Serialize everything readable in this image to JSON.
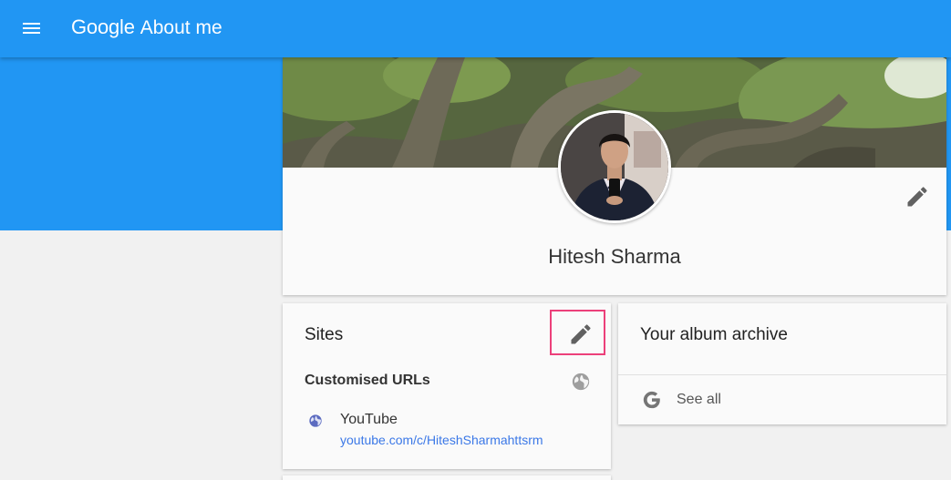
{
  "header": {
    "brand_google": "Google",
    "brand_product": "About me"
  },
  "profile": {
    "name": "Hitesh Sharma"
  },
  "sites": {
    "title": "Sites",
    "section_title": "Customised URLs",
    "links": [
      {
        "name": "YouTube",
        "url": "youtube.com/c/HiteshSharmahttsrm"
      }
    ]
  },
  "album": {
    "title": "Your album archive",
    "see_all_label": "See all"
  },
  "colors": {
    "app_bar": "#2196f3",
    "highlight_box": "#ec407a",
    "link": "#3b78e7"
  },
  "icons": {
    "menu": "menu-icon",
    "edit": "pencil-icon",
    "visibility": "globe-icon",
    "site": "globe-icon",
    "album": "google-g-icon"
  }
}
